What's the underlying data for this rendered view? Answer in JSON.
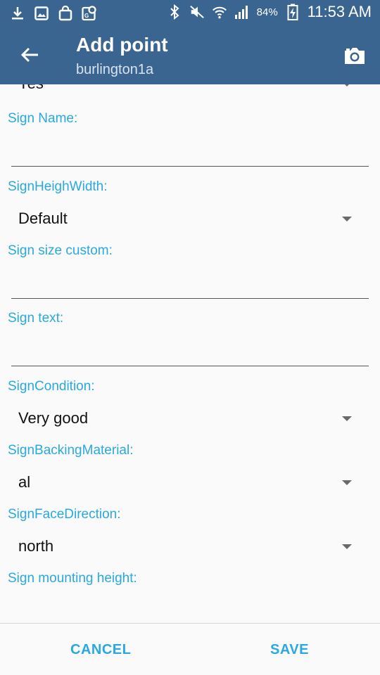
{
  "status_bar": {
    "battery": "84%",
    "time": "11:53 AM",
    "left_icons": [
      "download-icon",
      "image-icon",
      "shopping-bag-icon",
      "map-pin-icon"
    ],
    "right_icons": [
      "bluetooth-icon",
      "mute-icon",
      "wifi-icon",
      "signal-icon",
      "battery-charging-icon"
    ]
  },
  "toolbar": {
    "title": "Add point",
    "subtitle": "burlington1a",
    "back_icon": "arrow-left-icon",
    "camera_icon": "camera-icon"
  },
  "form": {
    "partial_value": "Yes",
    "fields": {
      "sign_name": {
        "label": "Sign Name:",
        "value": ""
      },
      "sign_height_width": {
        "label": "SignHeighWidth:",
        "value": "Default"
      },
      "sign_size_custom": {
        "label": "Sign size custom:",
        "value": ""
      },
      "sign_text": {
        "label": "Sign text:",
        "value": ""
      },
      "sign_condition": {
        "label": "SignCondition:",
        "value": "Very good"
      },
      "sign_backing_material": {
        "label": "SignBackingMaterial:",
        "value": "al"
      },
      "sign_face_direction": {
        "label": "SignFaceDirection:",
        "value": "north"
      },
      "sign_mounting_height": {
        "label": "Sign mounting height:",
        "value": ""
      }
    }
  },
  "actions": {
    "cancel": "CANCEL",
    "save": "SAVE"
  },
  "colors": {
    "toolbar": "#3a6591",
    "accent": "#29a9e0",
    "background": "#fafafa"
  }
}
